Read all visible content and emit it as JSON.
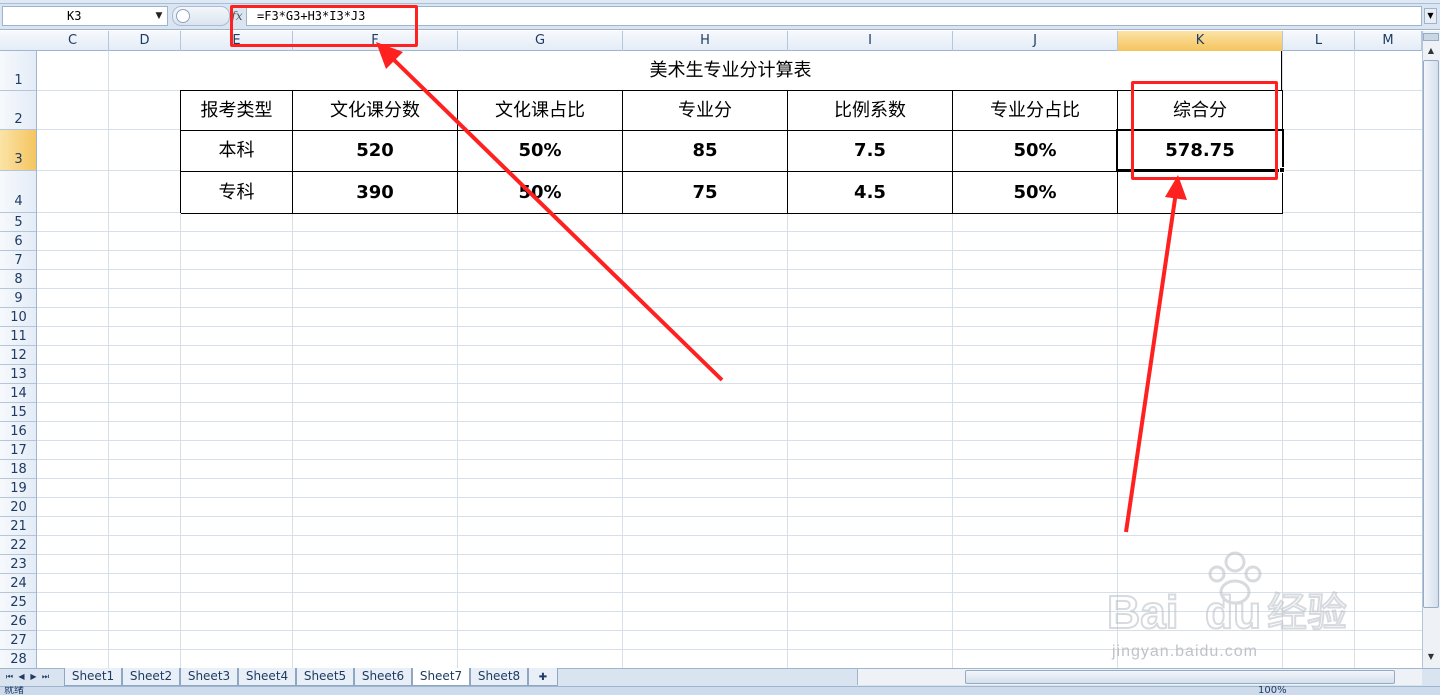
{
  "formula_bar": {
    "name_box": "K3",
    "fx_label": "fx",
    "formula": "=F3*G3+H3*I3*J3"
  },
  "columns": [
    "C",
    "D",
    "E",
    "F",
    "G",
    "H",
    "I",
    "J",
    "K",
    "L",
    "M"
  ],
  "rows": [
    "1",
    "2",
    "3",
    "4",
    "5",
    "6",
    "7",
    "8",
    "9",
    "10",
    "11",
    "12",
    "13",
    "14",
    "15",
    "16",
    "17",
    "18",
    "19",
    "20",
    "21",
    "22",
    "23",
    "24",
    "25",
    "26",
    "27",
    "28"
  ],
  "selected_cell": "K3",
  "table": {
    "title": "美术生专业分计算表",
    "headers": [
      "报考类型",
      "文化课分数",
      "文化课占比",
      "专业分",
      "比例系数",
      "专业分占比",
      "综合分"
    ],
    "rows": [
      [
        "本科",
        "520",
        "50%",
        "85",
        "7.5",
        "50%",
        "578.75"
      ],
      [
        "专科",
        "390",
        "50%",
        "75",
        "4.5",
        "50%",
        ""
      ]
    ]
  },
  "sheet_tabs": [
    "Sheet1",
    "Sheet2",
    "Sheet3",
    "Sheet4",
    "Sheet5",
    "Sheet6",
    "Sheet7",
    "Sheet8"
  ],
  "active_sheet": "Sheet7",
  "status": {
    "ready": "就绪",
    "zoom": "100%"
  },
  "watermark": {
    "logo": "Bai du 经验",
    "url": "jingyan.baidu.com"
  },
  "annotation_color": "#ff2020"
}
